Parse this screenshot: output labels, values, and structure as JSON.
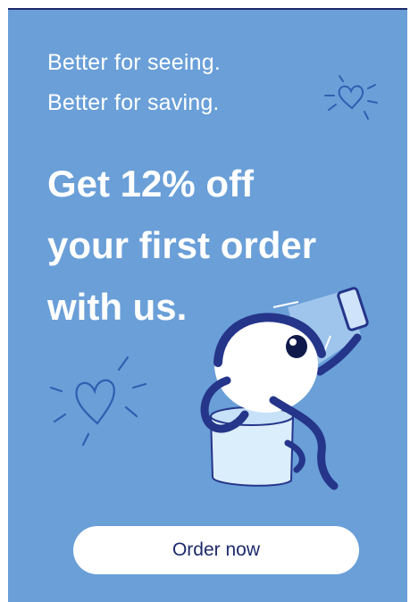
{
  "ad": {
    "tagline_1": "Better for seeing.",
    "tagline_2": "Better for saving.",
    "headline_lines": [
      "Get 12% off",
      "your first order",
      "with us."
    ],
    "cta_label": "Order now",
    "icons": [
      "heart-icon",
      "eye-mascot-illustration"
    ]
  },
  "colors": {
    "background": "#6a9fd8",
    "text": "#ffffff",
    "accent_navy": "#1d2a6b",
    "button_bg": "#ffffff"
  }
}
